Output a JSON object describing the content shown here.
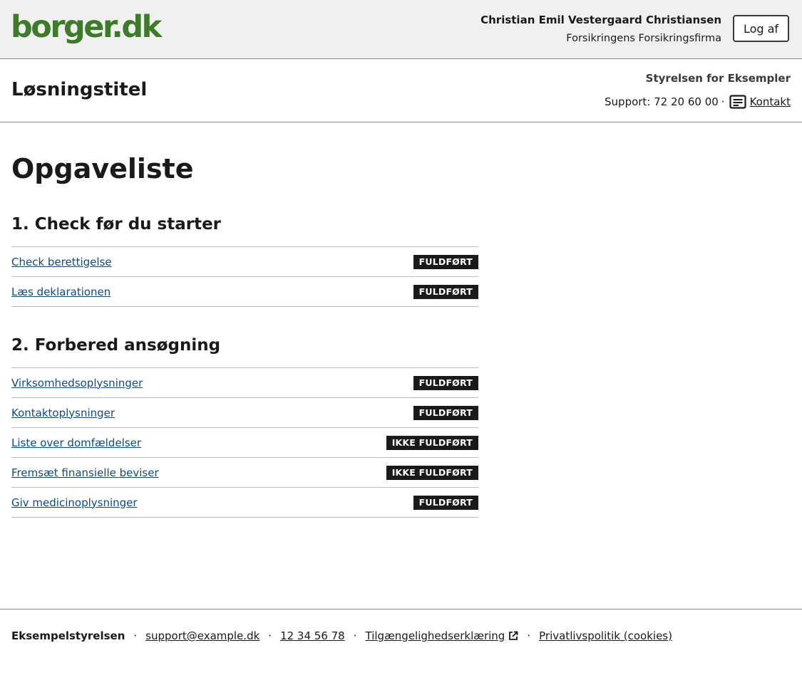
{
  "portal": {
    "logo": "borger.dk",
    "user_name": "Christian Emil Vestergaard Christiansen",
    "user_company": "Forsikringens Forsikringsfirma",
    "logout_label": "Log af"
  },
  "solution": {
    "title": "Løsningstitel",
    "authority": "Styrelsen for Eksempler",
    "support_label": "Support: 72 20 60 00",
    "separator": "·",
    "contact_label": "Kontakt",
    "contact_icon": "message-icon"
  },
  "main": {
    "page_title": "Opgaveliste",
    "sections": [
      {
        "heading": "1. Check før du starter",
        "tasks": [
          {
            "label": "Check berettigelse",
            "status": "FULDFØRT"
          },
          {
            "label": "Læs deklarationen",
            "status": "FULDFØRT"
          }
        ]
      },
      {
        "heading": "2. Forbered ansøgning",
        "tasks": [
          {
            "label": "Virksomhedsoplysninger",
            "status": "FULDFØRT"
          },
          {
            "label": "Kontaktoplysninger",
            "status": "FULDFØRT"
          },
          {
            "label": "Liste over domfældelser",
            "status": "IKKE FULDFØRT"
          },
          {
            "label": "Fremsæt finansielle beviser",
            "status": "IKKE FULDFØRT"
          },
          {
            "label": "Giv medicinoplysninger",
            "status": "FULDFØRT"
          }
        ]
      }
    ]
  },
  "footer": {
    "organization": "Eksempelstyrelsen",
    "separator": "·",
    "email": "support@example.dk",
    "phone": "12 34 56 78",
    "accessibility_label": "Tilgængelighedserklæring",
    "accessibility_icon": "external-link-icon",
    "privacy_label": "Privatlivspolitik (cookies)"
  },
  "colors": {
    "logo_green": "#3d7a2a",
    "link_blue": "#124a7a",
    "badge_bg": "#1a1a1a",
    "header_bg": "#f0f0f0"
  }
}
